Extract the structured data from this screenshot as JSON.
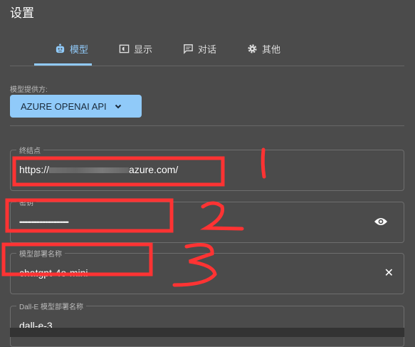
{
  "title": "设置",
  "tabs": [
    {
      "label": "模型",
      "icon": "robot-icon",
      "active": true
    },
    {
      "label": "显示",
      "icon": "display-icon"
    },
    {
      "label": "对话",
      "icon": "chat-icon"
    },
    {
      "label": "其他",
      "icon": "gear-icon"
    }
  ],
  "provider": {
    "label": "模型提供方:",
    "value": "AZURE OPENAI API"
  },
  "fields": {
    "endpoint": {
      "label": "终结点",
      "prefix": "https://",
      "suffix": "azure.com/"
    },
    "key": {
      "label": "密钥",
      "value": "••••••••••••••••••••••••••••••••"
    },
    "deployment": {
      "label": "模型部署名称",
      "value": "chatgpt-4o-mini"
    },
    "dalle": {
      "label": "Dall-E 模型部署名称",
      "value": "dall-e-3"
    }
  },
  "annotations": [
    "1",
    "2",
    "3"
  ],
  "colors": {
    "accent": "#90caf9",
    "background": "#4b4b4b",
    "annotation": "#ff3333"
  }
}
